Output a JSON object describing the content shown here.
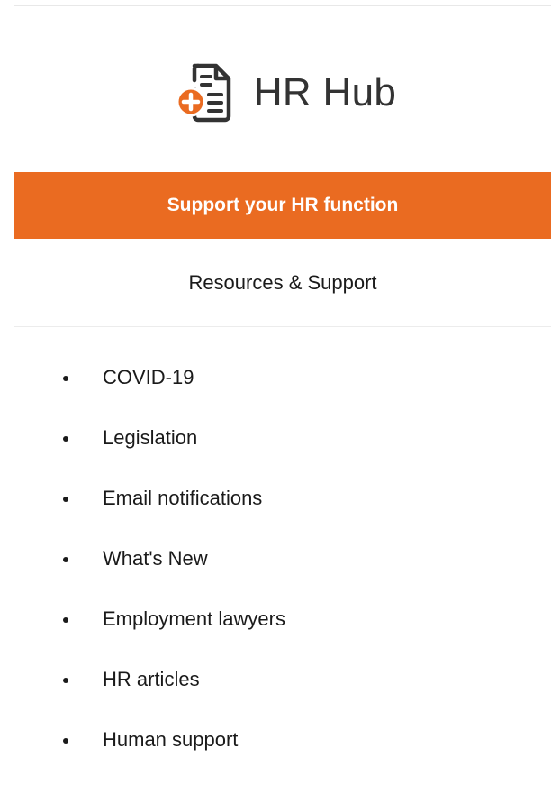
{
  "brand": {
    "name": "HR Hub",
    "icon": "document-plus-icon",
    "accent_color": "#ea6b21"
  },
  "banner": {
    "label": "Support your HR function"
  },
  "subheader": {
    "label": "Resources & Support"
  },
  "menu": {
    "items": [
      {
        "label": "COVID-19"
      },
      {
        "label": "Legislation"
      },
      {
        "label": "Email notifications"
      },
      {
        "label": "What's New"
      },
      {
        "label": "Employment lawyers"
      },
      {
        "label": "HR articles"
      },
      {
        "label": "Human support"
      }
    ]
  }
}
